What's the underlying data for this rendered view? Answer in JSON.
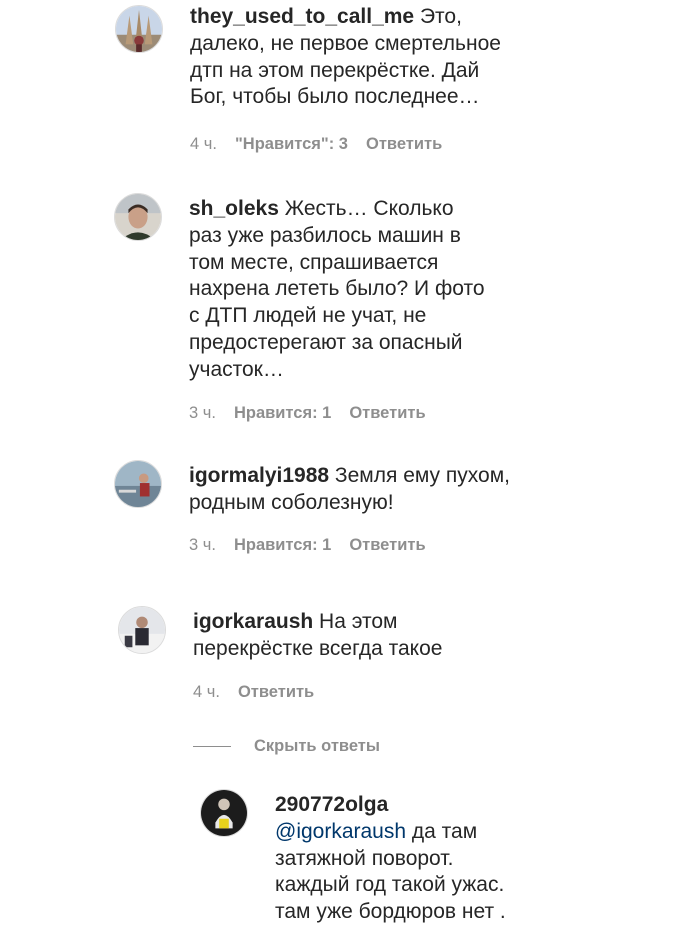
{
  "comments": [
    {
      "username": "they_used_to_call_me",
      "text": " Это, далеко, не первое смертельное дтп на этом перекрёстке. Дай Бог, чтобы было последнее…",
      "time": "4 ч.",
      "likes": "\"Нравится\": 3",
      "reply": "Ответить"
    },
    {
      "username": "sh_oleks",
      "text": " Жесть… Сколько раз уже разбилось машин в том месте, спрашивается нахрена лететь было? И фото с ДТП людей не учат, не предостерегают за опасный участок…",
      "time": "3 ч.",
      "likes": "Нравится: 1",
      "reply": "Ответить"
    },
    {
      "username": "igormalyi1988",
      "text": " Земля ему пухом, родным соболезную!",
      "time": "3 ч.",
      "likes": "Нравится: 1",
      "reply": "Ответить"
    },
    {
      "username": "igorkaraush",
      "text": " На этом перекрёстке всегда такое",
      "time": "4 ч.",
      "reply": "Ответить"
    }
  ],
  "hide_replies": "Скрыть ответы",
  "reply_comment": {
    "username": "290772olga",
    "mention": "@igorkaraush",
    "text": " да там затяжной поворот. каждый год такой ужас. там уже бордюров нет ."
  },
  "colors": {
    "text": "#262626",
    "meta": "#8e8e8e",
    "mention": "#00376b"
  }
}
